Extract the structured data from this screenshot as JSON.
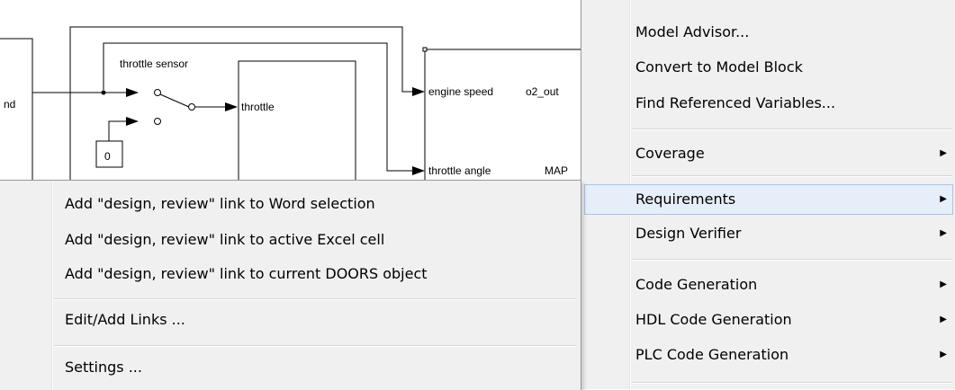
{
  "diagram": {
    "input_label": "nd",
    "sensor_label": "throttle sensor",
    "throttle_label": "throttle",
    "const_value": "0",
    "port_engine_speed": "engine speed",
    "port_o2_out": "o2_out",
    "port_throttle_angle": "throttle angle",
    "port_map": "MAP"
  },
  "context_menu": {
    "items": [
      {
        "label": "Model Advisor..."
      },
      {
        "label": "Convert to Model Block"
      },
      {
        "label": "Find Referenced Variables..."
      },
      {
        "label": "Coverage",
        "submenu": true
      },
      {
        "label": "Requirements",
        "submenu": true,
        "highlighted": true
      },
      {
        "label": "Design Verifier",
        "submenu": true
      },
      {
        "label": "Code Generation",
        "submenu": true
      },
      {
        "label": "HDL Code Generation",
        "submenu": true
      },
      {
        "label": "PLC Code Generation",
        "submenu": true
      }
    ],
    "submenu_arrow": "▶"
  },
  "requirements_submenu": {
    "items": [
      {
        "label": "Add \"design, review\" link to Word selection"
      },
      {
        "label": "Add \"design, review\" link to active Excel cell"
      },
      {
        "label": "Add \"design, review\" link to current DOORS object"
      },
      {
        "label": "Edit/Add Links ..."
      },
      {
        "label": "Settings ..."
      }
    ]
  },
  "colors": {
    "menu_bg": "#f0f0f0",
    "highlight_bg": "#e6eef9",
    "highlight_border": "#a8c4eb"
  }
}
